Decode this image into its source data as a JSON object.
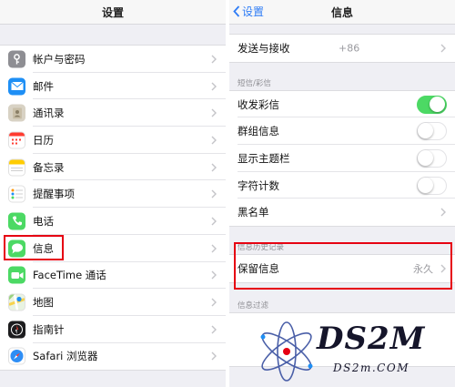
{
  "left": {
    "title": "设置",
    "items": [
      {
        "label": "帐户与密码",
        "icon": "key-icon"
      },
      {
        "label": "邮件",
        "icon": "mail-icon"
      },
      {
        "label": "通讯录",
        "icon": "contacts-icon"
      },
      {
        "label": "日历",
        "icon": "calendar-icon"
      },
      {
        "label": "备忘录",
        "icon": "notes-icon"
      },
      {
        "label": "提醒事项",
        "icon": "reminders-icon"
      },
      {
        "label": "电话",
        "icon": "phone-icon"
      },
      {
        "label": "信息",
        "icon": "messages-icon"
      },
      {
        "label": "FaceTime 通话",
        "icon": "facetime-icon"
      },
      {
        "label": "地图",
        "icon": "maps-icon"
      },
      {
        "label": "指南针",
        "icon": "compass-icon"
      },
      {
        "label": "Safari 浏览器",
        "icon": "safari-icon"
      }
    ]
  },
  "right": {
    "back_label": "设置",
    "title": "信息",
    "send_receive": {
      "label": "发送与接收",
      "value": "+86"
    },
    "sms_section": {
      "header": "短信/彩信",
      "items": [
        {
          "label": "收发彩信",
          "toggle": true
        },
        {
          "label": "群组信息",
          "toggle": false
        },
        {
          "label": "显示主题栏",
          "toggle": false
        },
        {
          "label": "字符计数",
          "toggle": false
        },
        {
          "label": "黑名单"
        }
      ]
    },
    "history_section": {
      "header": "信息历史记录",
      "keep": {
        "label": "保留信息",
        "value": "永久"
      }
    },
    "filter_section": {
      "header": "信息过滤"
    }
  },
  "watermark": {
    "brand": "DS2M",
    "domain": "DS2m.COM"
  },
  "colors": {
    "accent": "#2e7cf6",
    "toggle_on": "#4cd964",
    "highlight": "#e60012"
  }
}
